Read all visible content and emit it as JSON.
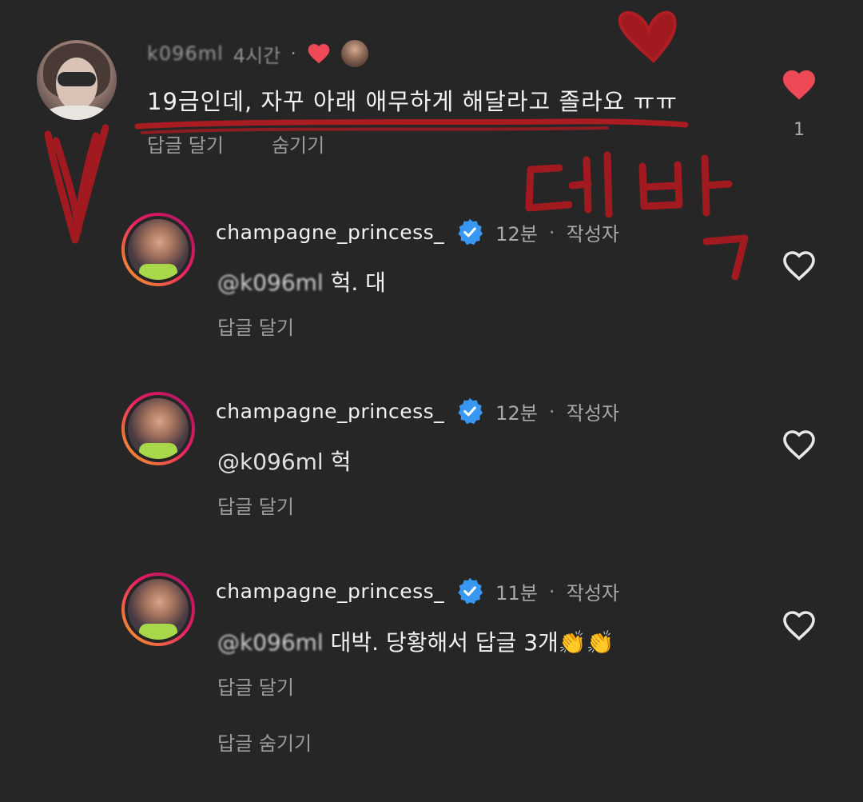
{
  "top_comment": {
    "username": "k096ml",
    "time": "4시간",
    "dot": "·",
    "text": "19금인데, 자꾸 아래 애무하게 해달라고 졸라요 ㅠㅠ",
    "reply_label": "답글 달기",
    "hide_label": "숨기기",
    "like_count": "1",
    "like_color": "#ed4956"
  },
  "replies": [
    {
      "username": "champagne_princess_",
      "time": "12분",
      "dot": "·",
      "role": "작성자",
      "mention": "@k096ml",
      "text": "헉. 대",
      "reply_label": "답글 달기"
    },
    {
      "username": "champagne_princess_",
      "time": "12분",
      "dot": "·",
      "role": "작성자",
      "mention": "@k096ml",
      "text": "헉",
      "reply_label": "답글 달기"
    },
    {
      "username": "champagne_princess_",
      "time": "11분",
      "dot": "·",
      "role": "작성자",
      "mention": "@k096ml",
      "text": "대박. 당황해서 답글 3개👏👏",
      "reply_label": "답글 달기"
    }
  ],
  "hide_replies_label": "답글 숨기기",
  "annotation": {
    "text": "대박",
    "color": "#b01e24"
  },
  "colors": {
    "background": "#262626",
    "verified": "#3897f0",
    "heart": "#ed4956"
  }
}
